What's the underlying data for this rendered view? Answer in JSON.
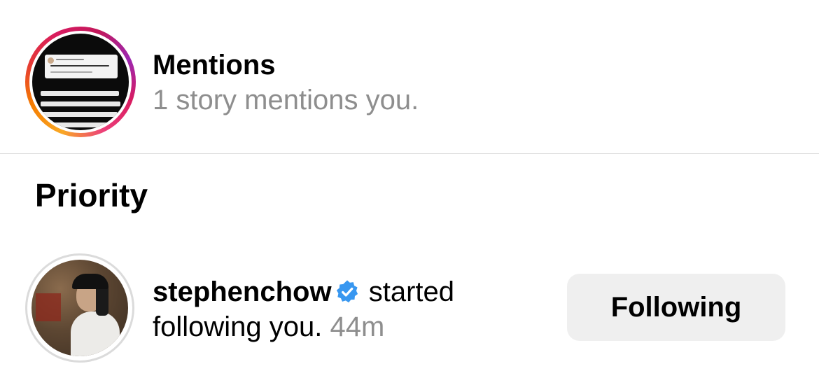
{
  "mentions": {
    "title": "Mentions",
    "subtitle": "1 story mentions you.",
    "story_ring_colors": [
      "#f9a825",
      "#e53935",
      "#d81b60",
      "#9c27b0"
    ]
  },
  "priority": {
    "section_title": "Priority",
    "notification": {
      "username": "stephenchow",
      "verified": true,
      "verified_color": "#3897f0",
      "action_text_part1": " started",
      "action_text_part2": "following you.",
      "time": "44m",
      "button_label": "Following"
    }
  },
  "colors": {
    "secondary_text": "#8e8e8e",
    "divider": "#dbdbdb",
    "button_bg": "#efefef"
  }
}
